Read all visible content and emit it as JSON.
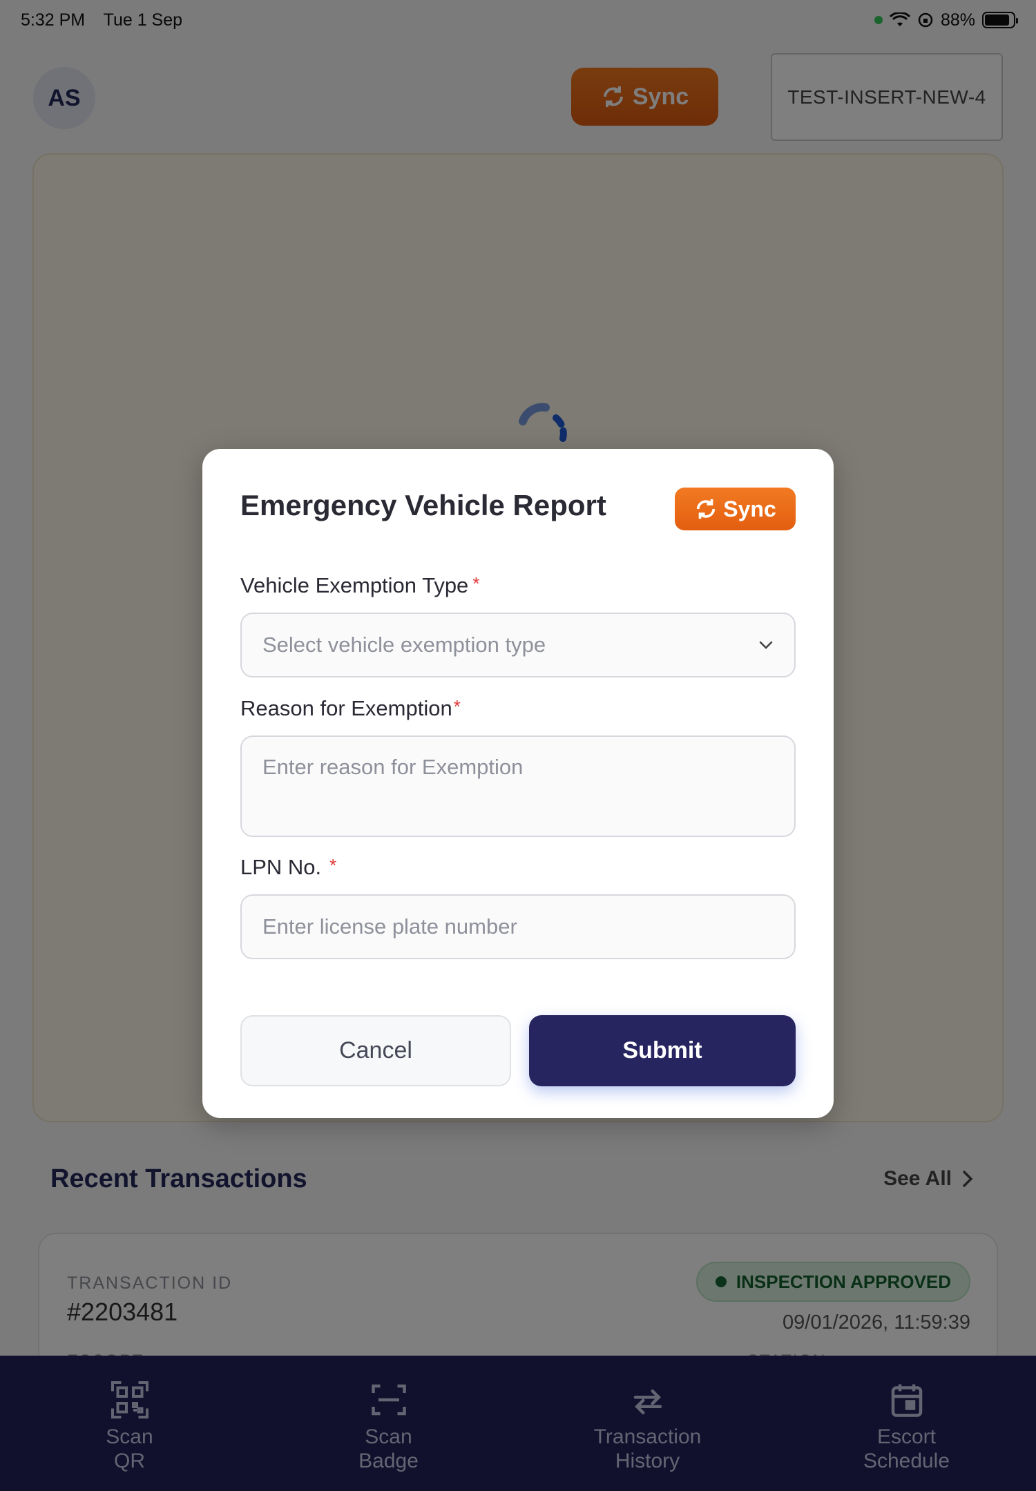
{
  "status_bar": {
    "time": "5:32 PM",
    "date": "Tue 1 Sep",
    "battery": "88%",
    "battery_level": 0.88
  },
  "header": {
    "avatar_initials": "AS",
    "sync_label": "Sync",
    "device_id": "TEST-INSERT-NEW-4"
  },
  "recent": {
    "title": "Recent Transactions",
    "see_all": "See All",
    "transaction": {
      "id_label": "TRANSACTION ID",
      "id": "#2203481",
      "status": "INSPECTION APPROVED",
      "datetime": "09/01/2026, 11:59:39",
      "sub_left": "ESCORT",
      "sub_right": "STATION"
    }
  },
  "modal": {
    "title": "Emergency Vehicle Report",
    "sync_label": "Sync",
    "exemption_type": {
      "label": "Vehicle Exemption Type",
      "required": "*",
      "placeholder": "Select vehicle exemption type"
    },
    "reason": {
      "label": "Reason for Exemption",
      "required": "*",
      "placeholder": "Enter reason for Exemption"
    },
    "lpn": {
      "label": "LPN No.",
      "required": "*",
      "placeholder": "Enter license plate number"
    },
    "cancel_label": "Cancel",
    "submit_label": "Submit"
  },
  "bottom_nav": [
    {
      "label_1": "Scan",
      "label_2": "QR",
      "icon": "qr-code-icon"
    },
    {
      "label_1": "Scan",
      "label_2": "Badge",
      "icon": "scan-badge-icon"
    },
    {
      "label_1": "Transaction",
      "label_2": "History",
      "icon": "swap-arrows-icon"
    },
    {
      "label_1": "Escort",
      "label_2": "Schedule",
      "icon": "calendar-icon"
    }
  ],
  "colors": {
    "accent_orange": "#ef6c1a",
    "navy": "#272560",
    "approved_green": "#166534"
  }
}
